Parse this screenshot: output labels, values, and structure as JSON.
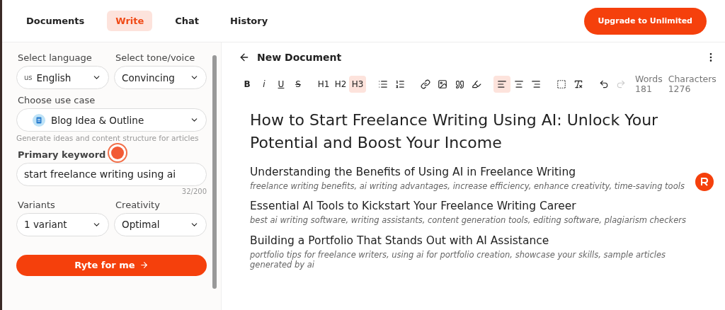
{
  "nav": {
    "tabs": [
      {
        "label": "Documents",
        "selected": false
      },
      {
        "label": "Write",
        "selected": true
      },
      {
        "label": "Chat",
        "selected": false
      },
      {
        "label": "History",
        "selected": false
      }
    ],
    "upgrade": "Upgrade to Unlimited"
  },
  "sidebar": {
    "language": {
      "label": "Select language",
      "flag": "us",
      "value": "English"
    },
    "tone": {
      "label": "Select tone/voice",
      "value": "Convincing"
    },
    "use_case": {
      "label": "Choose use case",
      "value": "Blog Idea & Outline",
      "hint": "Generate ideas and content structure for articles"
    },
    "keyword": {
      "label": "Primary keyword",
      "value": "start freelance writing using ai",
      "count": "32/200"
    },
    "variants": {
      "label": "Variants",
      "value": "1 variant"
    },
    "creativity": {
      "label": "Creativity",
      "value": "Optimal"
    },
    "submit": "Ryte for me"
  },
  "editor": {
    "title": "New Document",
    "format_buttons": [
      {
        "label": "B",
        "selected": false
      },
      {
        "label": "i",
        "selected": false
      },
      {
        "label": "U",
        "selected": false
      },
      {
        "label": "S",
        "selected": false
      }
    ],
    "heading_buttons": [
      {
        "label": "H1",
        "selected": false
      },
      {
        "label": "H2",
        "selected": false
      },
      {
        "label": "H3",
        "selected": true
      }
    ],
    "align_buttons": [
      {
        "selected": true
      },
      {
        "selected": false
      },
      {
        "selected": false
      }
    ],
    "redo_disabled": true,
    "stats": [
      {
        "label": "Words",
        "value": "181"
      },
      {
        "label": "Characters",
        "value": "1276"
      }
    ],
    "heading": "How to Start Freelance Writing Using AI: Unlock Your Potential and Boost Your Income",
    "sections": [
      {
        "title": "Understanding the Benefits of Using AI in Freelance Writing",
        "keywords": "freelance writing benefits, ai writing advantages, increase efficiency, enhance creativity, time-saving tools"
      },
      {
        "title": "Essential AI Tools to Kickstart Your Freelance Writing Career",
        "keywords": "best ai writing software, writing assistants, content generation tools, editing software, plagiarism checkers"
      },
      {
        "title": "Building a Portfolio That Stands Out with AI Assistance",
        "keywords": "portfolio tips for freelance writers, using ai for portfolio creation, showcase your skills, sample articles generated by ai"
      }
    ]
  }
}
